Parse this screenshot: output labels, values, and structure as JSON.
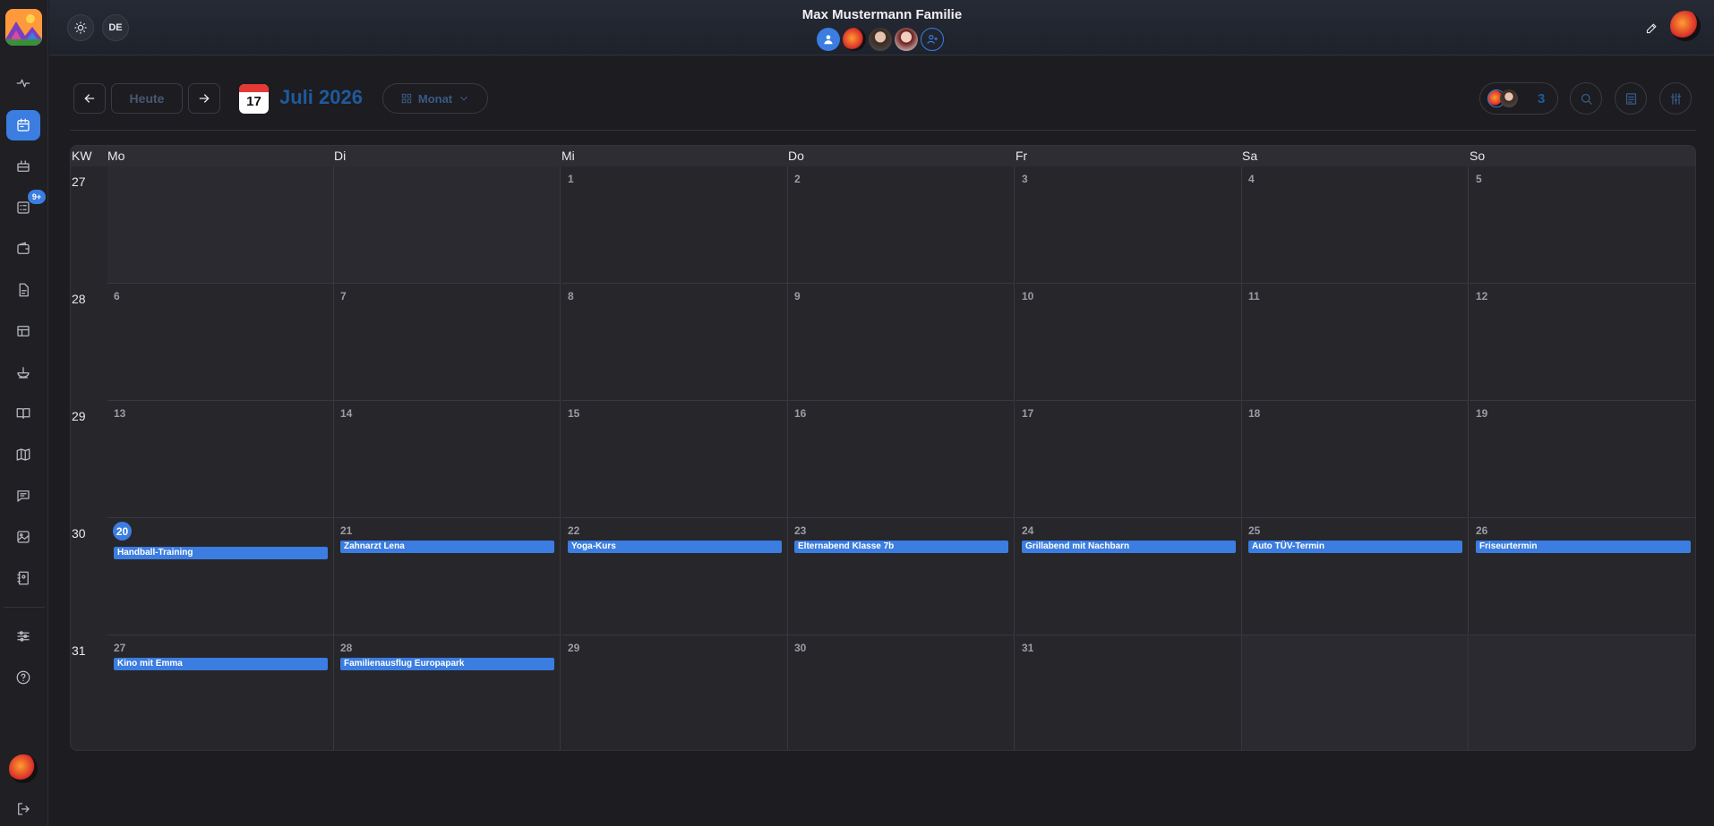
{
  "header": {
    "family_title": "Max Mustermann Familie",
    "language": "DE",
    "members": [
      "user-icon",
      "avatar-apple",
      "avatar-woman-1",
      "avatar-woman-2",
      "add-member-icon"
    ]
  },
  "sidebar": {
    "items": [
      "activity-icon",
      "calendar-icon",
      "calendar-week-icon",
      "tasks-icon",
      "wallet-icon",
      "document-icon",
      "table-icon",
      "bowl-icon",
      "book-icon",
      "map-icon",
      "chat-icon",
      "image-icon",
      "contacts-icon",
      "settings-icon",
      "help-icon",
      "logout-icon"
    ],
    "badge": "9+"
  },
  "toolbar": {
    "today_label": "Heute",
    "calendar_day": "17",
    "month_title": "Juli 2026",
    "view_label": "Monat",
    "member_count": "3"
  },
  "calendar": {
    "kw_label": "KW",
    "day_headers": [
      "Mo",
      "Di",
      "Mi",
      "Do",
      "Fr",
      "Sa",
      "So"
    ],
    "today": "20",
    "weeks": [
      {
        "kw": "27",
        "days": [
          "",
          "",
          "1",
          "2",
          "3",
          "4",
          "5"
        ]
      },
      {
        "kw": "28",
        "days": [
          "6",
          "7",
          "8",
          "9",
          "10",
          "11",
          "12"
        ]
      },
      {
        "kw": "29",
        "days": [
          "13",
          "14",
          "15",
          "16",
          "17",
          "18",
          "19"
        ]
      },
      {
        "kw": "30",
        "days": [
          "20",
          "21",
          "22",
          "23",
          "24",
          "25",
          "26"
        ]
      },
      {
        "kw": "31",
        "days": [
          "27",
          "28",
          "29",
          "30",
          "31",
          "",
          ""
        ]
      }
    ],
    "events": [
      {
        "week": 3,
        "day": 0,
        "title": "Handball-Training"
      },
      {
        "week": 3,
        "day": 1,
        "title": "Zahnarzt Lena"
      },
      {
        "week": 3,
        "day": 2,
        "title": "Yoga-Kurs"
      },
      {
        "week": 3,
        "day": 3,
        "title": "Elternabend Klasse 7b"
      },
      {
        "week": 3,
        "day": 4,
        "title": "Grillabend mit Nachbarn"
      },
      {
        "week": 3,
        "day": 5,
        "title": "Auto TÜV-Termin"
      },
      {
        "week": 3,
        "day": 6,
        "title": "Friseurtermin"
      },
      {
        "week": 4,
        "day": 0,
        "title": "Kino mit Emma"
      },
      {
        "week": 4,
        "day": 1,
        "title": "Familienausflug Europapark"
      }
    ]
  },
  "colors": {
    "accent": "#3b7de0",
    "background": "#1c1c21",
    "title_blue": "#1f5a9c"
  }
}
